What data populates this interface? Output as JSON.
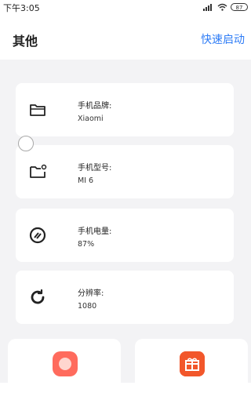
{
  "status": {
    "time": "下午3:05",
    "battery": "87"
  },
  "header": {
    "title": "其他",
    "action": "快速启动"
  },
  "cards": [
    {
      "icon": "folder-icon",
      "label": "手机品牌:",
      "value": "Xiaomi"
    },
    {
      "icon": "folder-badge-icon",
      "label": "手机型号:",
      "value": "MI 6"
    },
    {
      "icon": "battery-gauge-icon",
      "label": "手机电量:",
      "value": "87%"
    },
    {
      "icon": "refresh-icon",
      "label": "分辨率:",
      "value": "1080"
    }
  ],
  "tiles": [
    {
      "icon": "circle-app-icon",
      "accent": "#ff6b5d"
    },
    {
      "icon": "gift-icon",
      "accent": "#f2572b"
    }
  ]
}
